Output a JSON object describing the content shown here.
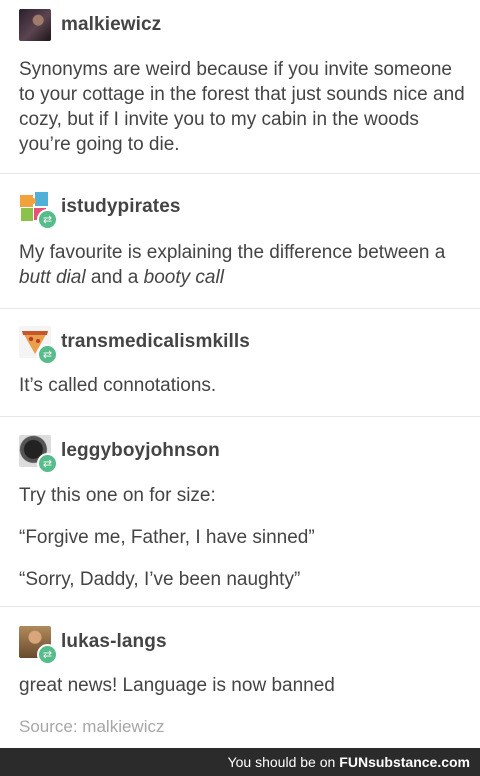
{
  "posts": [
    {
      "username": "malkiewicz",
      "avatar_icon": "avatar-dark-portrait",
      "reblog": false,
      "lines": [
        "Synonyms are weird because if you invite someone to your cottage in the forest that just sounds nice and cozy, but if I invite you to my cabin in the woods you’re going to die."
      ]
    },
    {
      "username": "istudypirates",
      "avatar_icon": "avatar-puzzle-pieces",
      "reblog": true,
      "lines_rich": {
        "a": "My favourite is explaining the difference between a ",
        "b": "butt dial",
        "c": " and a ",
        "d": "booty call"
      }
    },
    {
      "username": "transmedicalismkills",
      "avatar_icon": "avatar-pizza-slice",
      "reblog": true,
      "lines": [
        "It’s called connotations."
      ]
    },
    {
      "username": "leggyboyjohnson",
      "avatar_icon": "avatar-dark-cat",
      "reblog": true,
      "lines": [
        "Try this one on for size:",
        "“Forgive me, Father, I have sinned”",
        "“Sorry, Daddy, I’ve been naughty”"
      ]
    },
    {
      "username": "lukas-langs",
      "avatar_icon": "avatar-person-photo",
      "reblog": true,
      "lines": [
        "great news! Language is now banned"
      ]
    }
  ],
  "source": "Source: malkiewicz",
  "footer": {
    "prefix": "You should be on",
    "brand": "FUNsubstance.com"
  },
  "colors": {
    "reblog_badge": "#56bc8a",
    "footer_bg": "#2b2b2b",
    "divider": "#e6e6e6"
  }
}
